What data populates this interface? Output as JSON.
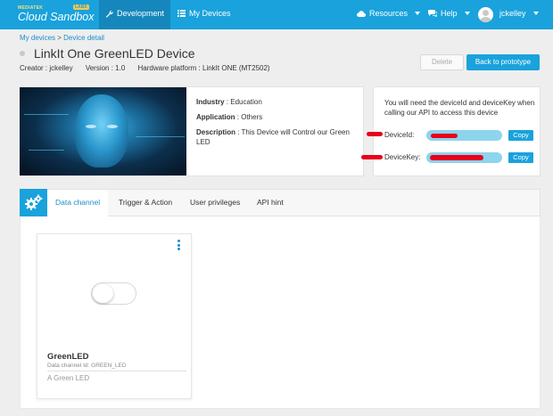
{
  "brand": {
    "small": "MEDIATEK",
    "lab": "LABS",
    "name": "Cloud Sandbox"
  },
  "nav": {
    "development": "Development",
    "my_devices": "My Devices",
    "resources": "Resources",
    "help": "Help",
    "user": "jckelley"
  },
  "breadcrumb": {
    "root": "My devices",
    "sep": ">",
    "current": "Device detail"
  },
  "device": {
    "title": "LinkIt One GreenLED Device",
    "creator": "Creator : jckelley",
    "version": "Version : 1.0",
    "platform": "Hardware platform : LinkIt ONE (MT2502)",
    "industry_label": "Industry",
    "industry": " : Education",
    "application_label": "Application",
    "application": " : Others",
    "description_label": "Description",
    "description": " : This Device will Control our Green LED"
  },
  "actions": {
    "delete": "Delete",
    "back": "Back to prototype"
  },
  "keys": {
    "note": "You will need the deviceId and deviceKey when calling our API to access this device",
    "device_id_label": "DeviceId:",
    "device_key_label": "DeviceKey:",
    "copy": "Copy"
  },
  "tabs": [
    "Data channel",
    "Trigger & Action",
    "User privileges",
    "API hint"
  ],
  "channel": {
    "name": "GreenLED",
    "id_text": "Data channel Id: GREEN_LED",
    "description": "A Green LED",
    "switch_on": false
  }
}
